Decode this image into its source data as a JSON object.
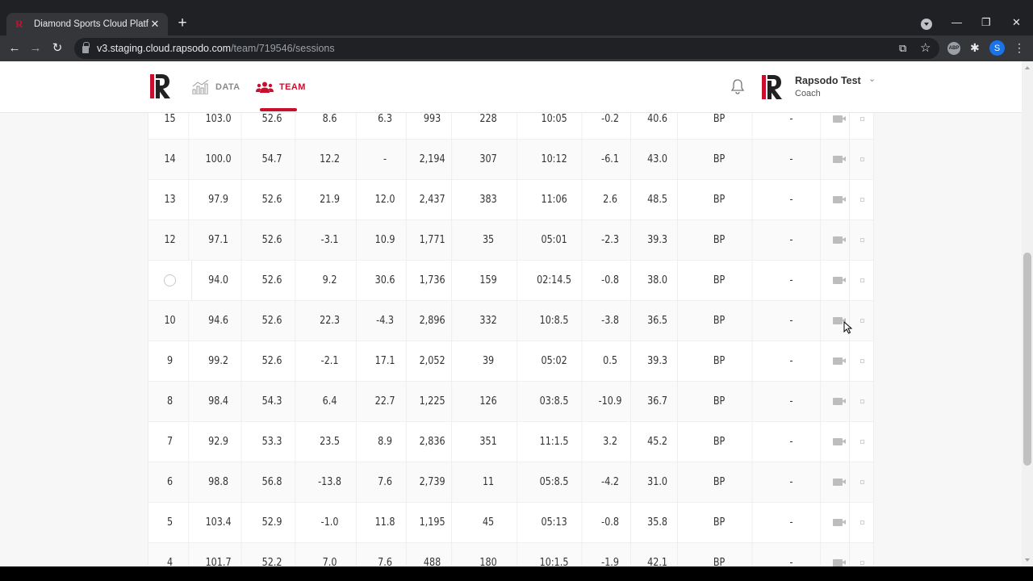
{
  "browser": {
    "tab_title": "Diamond Sports Cloud Platform",
    "tab_close": "✕",
    "new_tab": "+",
    "url_host": "v3.staging.cloud.rapsodo.com",
    "url_path": "/team/719546/sessions",
    "back": "←",
    "forward": "→",
    "reload": "↻",
    "minimize": "—",
    "maximize": "❐",
    "close": "✕",
    "open_in_app": "⧉",
    "bookmark": "☆",
    "adblock_label": "ABP",
    "extensions": "✱",
    "profile_initial": "S",
    "menu": "⋮"
  },
  "header": {
    "nav": [
      {
        "label": "DATA",
        "icon": "chart-icon"
      },
      {
        "label": "TEAM",
        "icon": "users-icon",
        "active": true
      }
    ],
    "user_name": "Rapsodo Test",
    "user_caret": "⌄",
    "user_role": "Coach"
  },
  "colors": {
    "brand_red": "#c8102e"
  },
  "table": {
    "rows": [
      {
        "no": "15",
        "c1": "103.0",
        "c2": "52.6",
        "c3": "8.6",
        "c4": "6.3",
        "c5": "993",
        "c6": "228",
        "c7": "10:05",
        "c8": "-0.2",
        "c9": "40.6",
        "type": "BP",
        "note": "-"
      },
      {
        "no": "14",
        "c1": "100.0",
        "c2": "54.7",
        "c3": "12.2",
        "c4": "-",
        "c5": "2,194",
        "c6": "307",
        "c7": "10:12",
        "c8": "-6.1",
        "c9": "43.0",
        "type": "BP",
        "note": "-"
      },
      {
        "no": "13",
        "c1": "97.9",
        "c2": "52.6",
        "c3": "21.9",
        "c4": "12.0",
        "c5": "2,437",
        "c6": "383",
        "c7": "11:06",
        "c8": "2.6",
        "c9": "48.5",
        "type": "BP",
        "note": "-"
      },
      {
        "no": "12",
        "c1": "97.1",
        "c2": "52.6",
        "c3": "-3.1",
        "c4": "10.9",
        "c5": "1,771",
        "c6": "35",
        "c7": "05:01",
        "c8": "-2.3",
        "c9": "39.3",
        "type": "BP",
        "note": "-"
      },
      {
        "no": "",
        "c1": "94.0",
        "c2": "52.6",
        "c3": "9.2",
        "c4": "30.6",
        "c5": "1,736",
        "c6": "159",
        "c7": "02:14.5",
        "c8": "-0.8",
        "c9": "38.0",
        "type": "BP",
        "note": "-"
      },
      {
        "no": "10",
        "c1": "94.6",
        "c2": "52.6",
        "c3": "22.3",
        "c4": "-4.3",
        "c5": "2,896",
        "c6": "332",
        "c7": "10:8.5",
        "c8": "-3.8",
        "c9": "36.5",
        "type": "BP",
        "note": "-"
      },
      {
        "no": "9",
        "c1": "99.2",
        "c2": "52.6",
        "c3": "-2.1",
        "c4": "17.1",
        "c5": "2,052",
        "c6": "39",
        "c7": "05:02",
        "c8": "0.5",
        "c9": "39.3",
        "type": "BP",
        "note": "-"
      },
      {
        "no": "8",
        "c1": "98.4",
        "c2": "54.3",
        "c3": "6.4",
        "c4": "22.7",
        "c5": "1,225",
        "c6": "126",
        "c7": "03:8.5",
        "c8": "-10.9",
        "c9": "36.7",
        "type": "BP",
        "note": "-"
      },
      {
        "no": "7",
        "c1": "92.9",
        "c2": "53.3",
        "c3": "23.5",
        "c4": "8.9",
        "c5": "2,836",
        "c6": "351",
        "c7": "11:1.5",
        "c8": "3.2",
        "c9": "45.2",
        "type": "BP",
        "note": "-"
      },
      {
        "no": "6",
        "c1": "98.8",
        "c2": "56.8",
        "c3": "-13.8",
        "c4": "7.6",
        "c5": "2,739",
        "c6": "11",
        "c7": "05:8.5",
        "c8": "-4.2",
        "c9": "31.0",
        "type": "BP",
        "note": "-"
      },
      {
        "no": "5",
        "c1": "103.4",
        "c2": "52.9",
        "c3": "-1.0",
        "c4": "11.8",
        "c5": "1,195",
        "c6": "45",
        "c7": "05:13",
        "c8": "-0.8",
        "c9": "35.8",
        "type": "BP",
        "note": "-"
      },
      {
        "no": "4",
        "c1": "101.7",
        "c2": "52.2",
        "c3": "7.0",
        "c4": "7.6",
        "c5": "488",
        "c6": "180",
        "c7": "10:1.5",
        "c8": "-1.9",
        "c9": "42.1",
        "type": "BP",
        "note": "-"
      }
    ]
  }
}
